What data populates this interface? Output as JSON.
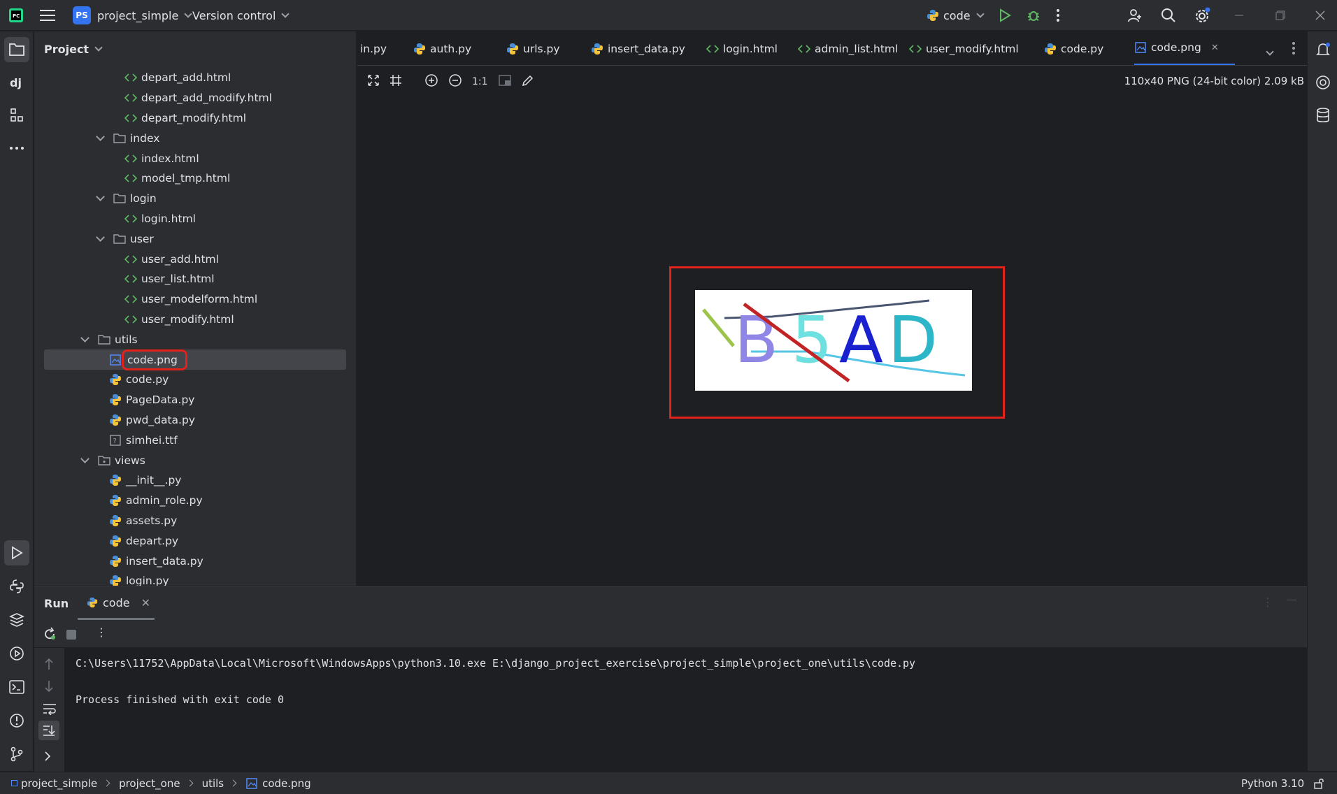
{
  "titlebar": {
    "project_badge": "PS",
    "project_name": "project_simple",
    "vcs_label": "Version control",
    "run_config": "code"
  },
  "project_panel": {
    "title": "Project",
    "tree": [
      {
        "label": "depart_add.html",
        "type": "html",
        "depth": 3
      },
      {
        "label": "depart_add_modify.html",
        "type": "html",
        "depth": 3
      },
      {
        "label": "depart_modify.html",
        "type": "html",
        "depth": 3
      },
      {
        "label": "index",
        "type": "folder",
        "depth": 2
      },
      {
        "label": "index.html",
        "type": "html",
        "depth": 3
      },
      {
        "label": "model_tmp.html",
        "type": "html",
        "depth": 3
      },
      {
        "label": "login",
        "type": "folder",
        "depth": 2
      },
      {
        "label": "login.html",
        "type": "html",
        "depth": 3
      },
      {
        "label": "user",
        "type": "folder",
        "depth": 2
      },
      {
        "label": "user_add.html",
        "type": "html",
        "depth": 3
      },
      {
        "label": "user_list.html",
        "type": "html",
        "depth": 3
      },
      {
        "label": "user_modelform.html",
        "type": "html",
        "depth": 3
      },
      {
        "label": "user_modify.html",
        "type": "html",
        "depth": 3
      },
      {
        "label": "utils",
        "type": "folder",
        "depth": 1
      },
      {
        "label": "code.png",
        "type": "image",
        "depth": 2,
        "selected": true
      },
      {
        "label": "code.py",
        "type": "python",
        "depth": 2
      },
      {
        "label": "PageData.py",
        "type": "python",
        "depth": 2
      },
      {
        "label": "pwd_data.py",
        "type": "python",
        "depth": 2
      },
      {
        "label": "simhei.ttf",
        "type": "font",
        "depth": 2
      },
      {
        "label": "views",
        "type": "package",
        "depth": 1
      },
      {
        "label": "__init__.py",
        "type": "python",
        "depth": 2
      },
      {
        "label": "admin_role.py",
        "type": "python",
        "depth": 2
      },
      {
        "label": "assets.py",
        "type": "python",
        "depth": 2
      },
      {
        "label": "depart.py",
        "type": "python",
        "depth": 2
      },
      {
        "label": "insert_data.py",
        "type": "python",
        "depth": 2
      },
      {
        "label": "login.py",
        "type": "python",
        "depth": 2
      }
    ]
  },
  "tabs": [
    {
      "label": "in.py",
      "type": "none"
    },
    {
      "label": "auth.py",
      "type": "python"
    },
    {
      "label": "urls.py",
      "type": "python"
    },
    {
      "label": "insert_data.py",
      "type": "python"
    },
    {
      "label": "login.html",
      "type": "html"
    },
    {
      "label": "admin_list.html",
      "type": "html"
    },
    {
      "label": "user_modify.html",
      "type": "html"
    },
    {
      "label": "code.py",
      "type": "python"
    },
    {
      "label": "code.png",
      "type": "image",
      "active": true
    }
  ],
  "image_viewer": {
    "zoom_label": "1:1",
    "meta": "110x40 PNG (24-bit color) 2.09 kB",
    "captcha_text": [
      "B",
      "5",
      "A",
      "D"
    ],
    "captcha_colors": [
      "#8f86e6",
      "#6ee0e0",
      "#1a22d0",
      "#2cb6c8"
    ]
  },
  "run_panel": {
    "title": "Run",
    "tab_label": "code",
    "command": "C:\\Users\\11752\\AppData\\Local\\Microsoft\\WindowsApps\\python3.10.exe E:\\django_project_exercise\\project_simple\\project_one\\utils\\code.py",
    "exit_message": "Process finished with exit code 0"
  },
  "statusbar": {
    "breadcrumb": [
      "project_simple",
      "project_one",
      "utils",
      "code.png"
    ],
    "interpreter": "Python 3.10"
  },
  "colors": {
    "accent": "#3574f0",
    "highlight_box": "#e4221c"
  }
}
